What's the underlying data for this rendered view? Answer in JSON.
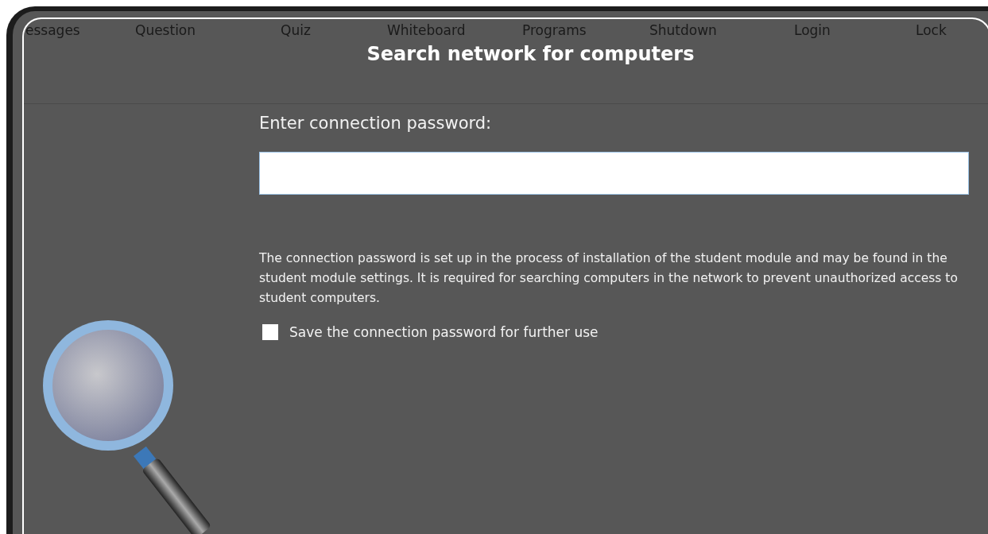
{
  "toolbar": {
    "items": [
      {
        "label": "essages"
      },
      {
        "label": "Question"
      },
      {
        "label": "Quiz"
      },
      {
        "label": "Whiteboard"
      },
      {
        "label": "Programs"
      },
      {
        "label": "Shutdown"
      },
      {
        "label": "Login"
      },
      {
        "label": "Lock"
      }
    ]
  },
  "dialog": {
    "title": "Search network for computers",
    "password_label": "Enter connection password:",
    "description": "The connection password is set up in the process of installation of the student module and may be found in the student module settings. It is required for searching computers in the network to prevent unauthorized access to student computers.",
    "save_password": {
      "label": "Save the connection password for further use",
      "checked": false
    }
  }
}
